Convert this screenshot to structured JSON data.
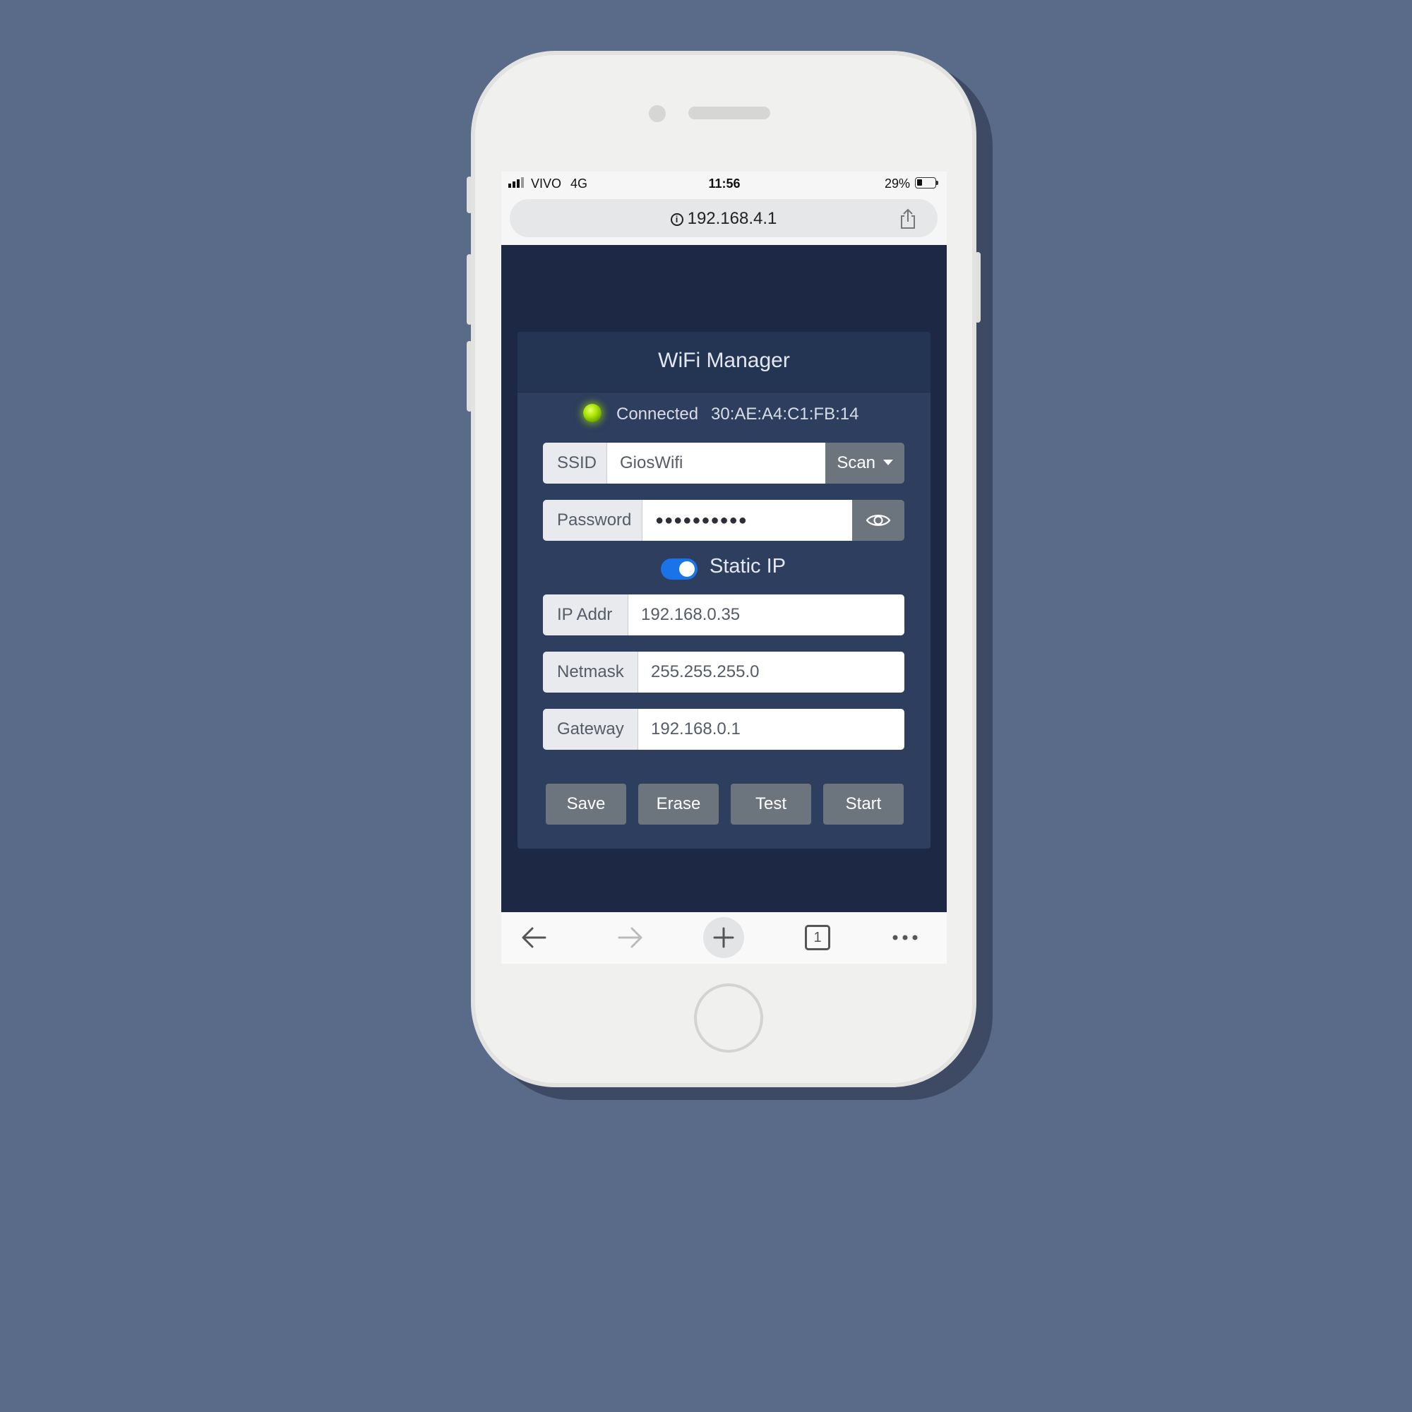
{
  "status_bar": {
    "carrier": "VIVO",
    "network": "4G",
    "time": "11:56",
    "battery": "29%",
    "battery_level": 0.29
  },
  "browser": {
    "url": "192.168.4.1",
    "tab_count": "1"
  },
  "wifi_manager": {
    "title": "WiFi Manager",
    "connection_status": "Connected",
    "mac_address": "30:AE:A4:C1:FB:14",
    "ssid": {
      "label": "SSID",
      "value": "GiosWifi",
      "scan_label": "Scan"
    },
    "password": {
      "label": "Password",
      "value": "●●●●●●●●●●"
    },
    "static_ip": {
      "label": "Static IP",
      "enabled": true
    },
    "ip_addr": {
      "label": "IP Addr",
      "value": "192.168.0.35"
    },
    "netmask": {
      "label": "Netmask",
      "value": "255.255.255.0"
    },
    "gateway": {
      "label": "Gateway",
      "value": "192.168.0.1"
    },
    "buttons": {
      "save": "Save",
      "erase": "Erase",
      "test": "Test",
      "start": "Start"
    }
  },
  "colors": {
    "background": "#5a6b89",
    "page_background": "#1d2844",
    "card": "#2d3e5e",
    "card_header": "#243453",
    "button": "#6c757d",
    "toggle_on": "#1a73e8",
    "led_connected": "#a8e400"
  }
}
